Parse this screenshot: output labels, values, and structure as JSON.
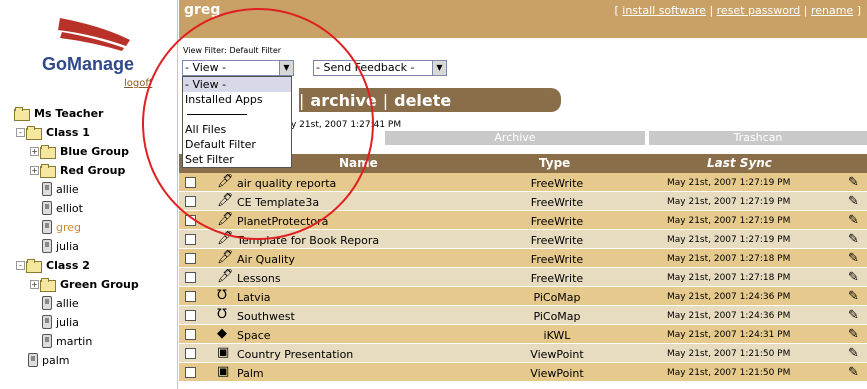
{
  "brand": {
    "name": "GoManage",
    "logoff": "logoff"
  },
  "tree": [
    {
      "label": "Ms Teacher",
      "bold": true,
      "type": "folder",
      "level": 0
    },
    {
      "label": "Class 1",
      "bold": true,
      "type": "folder",
      "level": 1,
      "pm": "-"
    },
    {
      "label": "Blue Group",
      "bold": true,
      "type": "folder",
      "level": 2,
      "pm": "+"
    },
    {
      "label": "Red Group",
      "bold": true,
      "type": "folder",
      "level": 2,
      "pm": "+"
    },
    {
      "label": "allie",
      "type": "palm",
      "level": 2
    },
    {
      "label": "elliot",
      "type": "palm",
      "level": 2
    },
    {
      "label": "greg",
      "type": "palm",
      "level": 2,
      "selected": true
    },
    {
      "label": "julia",
      "type": "palm",
      "level": 2
    },
    {
      "label": "Class 2",
      "bold": true,
      "type": "folder",
      "level": 1,
      "pm": "-"
    },
    {
      "label": "Green Group",
      "bold": true,
      "type": "folder",
      "level": 2,
      "pm": "+"
    },
    {
      "label": "allie",
      "type": "palm",
      "level": 2
    },
    {
      "label": "julia",
      "type": "palm",
      "level": 2
    },
    {
      "label": "martin",
      "type": "palm",
      "level": 2
    },
    {
      "label": "palm",
      "type": "palm",
      "level": 1
    }
  ],
  "header": {
    "username": "greg",
    "links": [
      "install software",
      "reset password",
      "rename"
    ],
    "link_prefix": "[ ",
    "link_sep": " | ",
    "link_suffix": " ]"
  },
  "filter": {
    "label": "View Filter: Default Filter",
    "view_value": "- View -",
    "feedback_value": "- Send Feedback -",
    "options": [
      "- View -",
      "Installed Apps",
      "",
      "All Files",
      "Default Filter",
      "Set Filter"
    ]
  },
  "actions": [
    "archive",
    "delete"
  ],
  "last_sync_text": "y 21st, 2007 1:27:41 PM",
  "tabs": {
    "client": "nt",
    "archive": "Archive",
    "trash": "Trashcan"
  },
  "columns": {
    "name": "Name",
    "type": "Type",
    "last_sync": "Last Sync"
  },
  "rows": [
    {
      "name": "air quality reporta",
      "type": "FreeWrite",
      "sync": "May 21st, 2007 1:27:19 PM",
      "icon": "freewrite-icon"
    },
    {
      "name": "CE Template3a",
      "type": "FreeWrite",
      "sync": "May 21st, 2007 1:27:19 PM",
      "icon": "freewrite-icon"
    },
    {
      "name": "PlanetProtectora",
      "type": "FreeWrite",
      "sync": "May 21st, 2007 1:27:19 PM",
      "icon": "freewrite-icon"
    },
    {
      "name": "Template for Book Repora",
      "type": "FreeWrite",
      "sync": "May 21st, 2007 1:27:19 PM",
      "icon": "freewrite-icon"
    },
    {
      "name": "Air Quality",
      "type": "FreeWrite",
      "sync": "May 21st, 2007 1:27:18 PM",
      "icon": "freewrite-icon"
    },
    {
      "name": "Lessons",
      "type": "FreeWrite",
      "sync": "May 21st, 2007 1:27:18 PM",
      "icon": "freewrite-icon"
    },
    {
      "name": "Latvia",
      "type": "PiCoMap",
      "sync": "May 21st, 2007 1:24:36 PM",
      "icon": "picomap-icon"
    },
    {
      "name": "Southwest",
      "type": "PiCoMap",
      "sync": "May 21st, 2007 1:24:36 PM",
      "icon": "picomap-icon"
    },
    {
      "name": "Space",
      "type": "iKWL",
      "sync": "May 21st, 2007 1:24:31 PM",
      "icon": "ikwl-icon"
    },
    {
      "name": "Country Presentation",
      "type": "ViewPoint",
      "sync": "May 21st, 2007 1:21:50 PM",
      "icon": "viewpoint-icon"
    },
    {
      "name": "Palm",
      "type": "ViewPoint",
      "sync": "May 21st, 2007 1:21:50 PM",
      "icon": "viewpoint-icon"
    }
  ],
  "colors": {
    "header_tan": "#c9a066",
    "dark_brown": "#8a6e4a",
    "row_odd": "#e6c98c",
    "row_even": "#e8dcc0",
    "highlight_circle": "#e02020"
  }
}
